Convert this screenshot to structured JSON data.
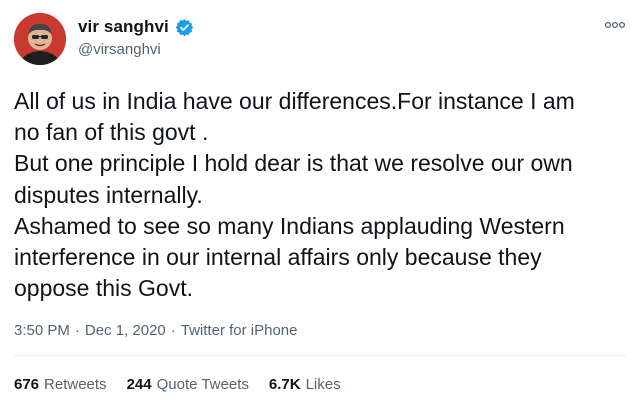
{
  "user": {
    "display_name": "vir sanghvi",
    "handle": "@virsanghvi",
    "verified_icon": "verified-badge-icon",
    "verified_color": "#1d9bf0"
  },
  "more_icon": "ellipsis-icon",
  "tweet": {
    "lines": [
      "All of us in India have our differences.For instance I am",
      "no fan of this govt .",
      "But one principle I hold dear is that we resolve our own",
      "disputes internally.",
      "Ashamed to see so many Indians applauding Western",
      "interference in our internal affairs only because they",
      "oppose this Govt."
    ]
  },
  "meta": {
    "time": "3:50 PM",
    "separator": "·",
    "date": "Dec 1, 2020",
    "source": "Twitter for iPhone"
  },
  "stats": {
    "retweets_count": "676",
    "retweets_label": "Retweets",
    "quotes_count": "244",
    "quotes_label": "Quote Tweets",
    "likes_count": "6.7K",
    "likes_label": "Likes"
  }
}
